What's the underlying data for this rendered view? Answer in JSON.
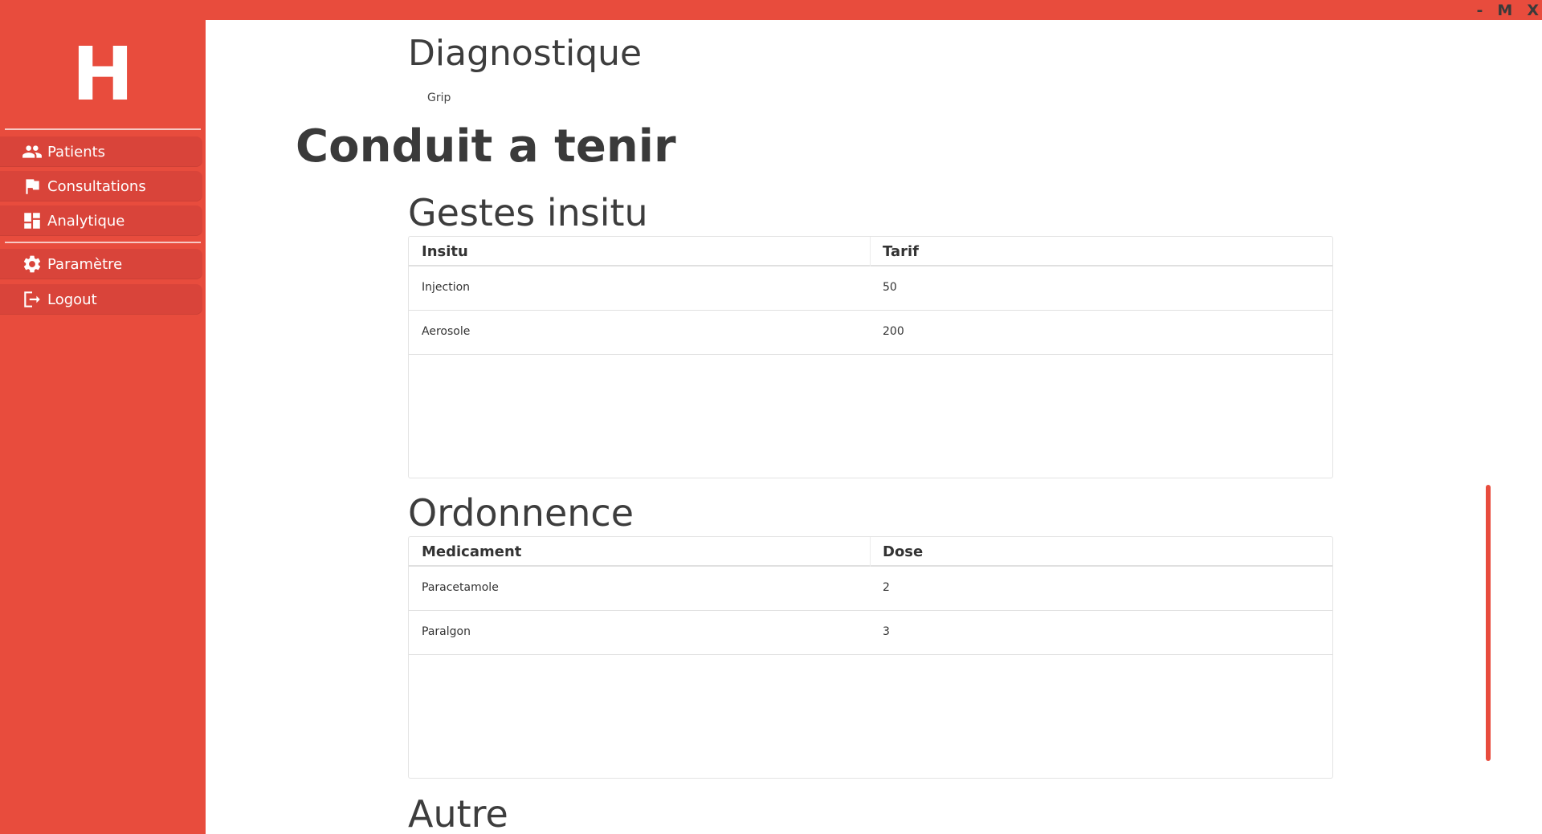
{
  "window": {
    "minimize_label": "-",
    "maximize_label": "M",
    "close_label": "X"
  },
  "sidebar": {
    "logo": "H",
    "items": [
      {
        "label": "Patients",
        "icon": "people-icon"
      },
      {
        "label": "Consultations",
        "icon": "flag-icon"
      },
      {
        "label": "Analytique",
        "icon": "dashboard-icon"
      },
      {
        "label": "Paramètre",
        "icon": "gear-icon"
      },
      {
        "label": "Logout",
        "icon": "logout-icon"
      }
    ]
  },
  "main": {
    "diagnostique_title": "Diagnostique",
    "diagnostique_value": "Grip",
    "conduit_title": "Conduit a tenir",
    "gestes": {
      "title": "Gestes insitu",
      "headers": [
        "Insitu",
        "Tarif"
      ],
      "rows": [
        [
          "Injection",
          "50"
        ],
        [
          "Aerosole",
          "200"
        ]
      ]
    },
    "ordonnence": {
      "title": "Ordonnence",
      "headers": [
        "Medicament",
        "Dose"
      ],
      "rows": [
        [
          "Paracetamole",
          "2"
        ],
        [
          "Paralgon",
          "3"
        ]
      ]
    },
    "autre_title": "Autre"
  },
  "colors": {
    "accent": "#e84c3d",
    "sidebar_item": "#d9443a",
    "text": "#333333"
  }
}
